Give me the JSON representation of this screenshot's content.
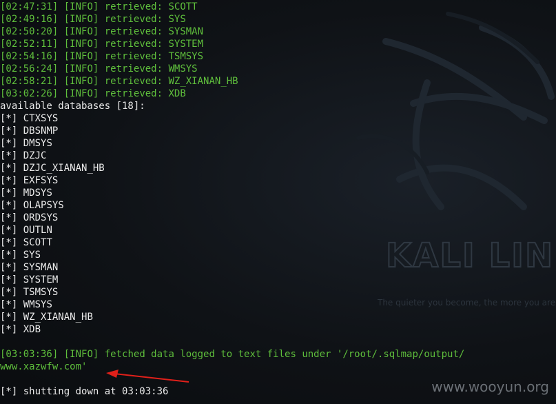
{
  "log_lines": [
    {
      "ts": "[02:47:31]",
      "level": "[INFO]",
      "msg": "retrieved: SCOTT"
    },
    {
      "ts": "[02:49:16]",
      "level": "[INFO]",
      "msg": "retrieved: SYS"
    },
    {
      "ts": "[02:50:20]",
      "level": "[INFO]",
      "msg": "retrieved: SYSMAN"
    },
    {
      "ts": "[02:52:11]",
      "level": "[INFO]",
      "msg": "retrieved: SYSTEM"
    },
    {
      "ts": "[02:54:16]",
      "level": "[INFO]",
      "msg": "retrieved: TSMSYS"
    },
    {
      "ts": "[02:56:24]",
      "level": "[INFO]",
      "msg": "retrieved: WMSYS"
    },
    {
      "ts": "[02:58:21]",
      "level": "[INFO]",
      "msg": "retrieved: WZ_XIANAN_HB"
    },
    {
      "ts": "[03:02:26]",
      "level": "[INFO]",
      "msg": "retrieved: XDB"
    }
  ],
  "databases_header": "available databases [18]:",
  "db_prefix": "[*]",
  "databases": [
    "CTXSYS",
    "DBSNMP",
    "DMSYS",
    "DZJC",
    "DZJC_XIANAN_HB",
    "EXFSYS",
    "MDSYS",
    "OLAPSYS",
    "ORDSYS",
    "OUTLN",
    "SCOTT",
    "SYS",
    "SYSMAN",
    "SYSTEM",
    "TSMSYS",
    "WMSYS",
    "WZ_XIANAN_HB",
    "XDB"
  ],
  "fetched": {
    "ts": "[03:03:36]",
    "level": "[INFO]",
    "msg": "fetched data logged to text files under '/root/.sqlmap/output/",
    "continuation": "www.xazwfw.com'"
  },
  "shutdown": {
    "prefix": "[*]",
    "msg": "shutting down at 03:03:36"
  },
  "wallpaper": {
    "logo": "KALI LINU",
    "tagline": "The quieter you become, the more you are"
  },
  "watermark": "www.wooyun.org",
  "colors": {
    "log_green": "#5fbf3c",
    "text_white": "#eaeaea",
    "background": "#0d0f12",
    "arrow_red": "#e0201a"
  }
}
